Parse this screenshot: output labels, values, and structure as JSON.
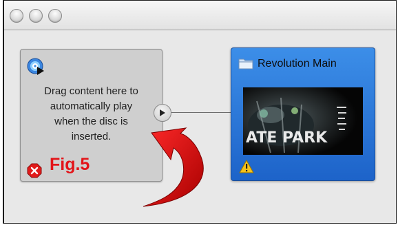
{
  "window": {
    "controls": [
      "close",
      "minimize",
      "zoom"
    ]
  },
  "first_play_tile": {
    "icon": "dvd-disc-play-icon",
    "text": "Drag content here to\nautomatically play\nwhen the disc is\ninserted.",
    "status_icon": "error-icon"
  },
  "connection": {
    "knob_icon": "triangle-right-icon"
  },
  "menu_tile": {
    "icon": "folder-icon",
    "title": "Revolution Main",
    "thumbnail_text": "ATE PARK",
    "status_icon": "warning-icon",
    "accent": "#2a75d8"
  },
  "annotation": {
    "label": "Fig.5",
    "color": "#e31419",
    "arrow_icon": "curved-arrow-icon"
  }
}
